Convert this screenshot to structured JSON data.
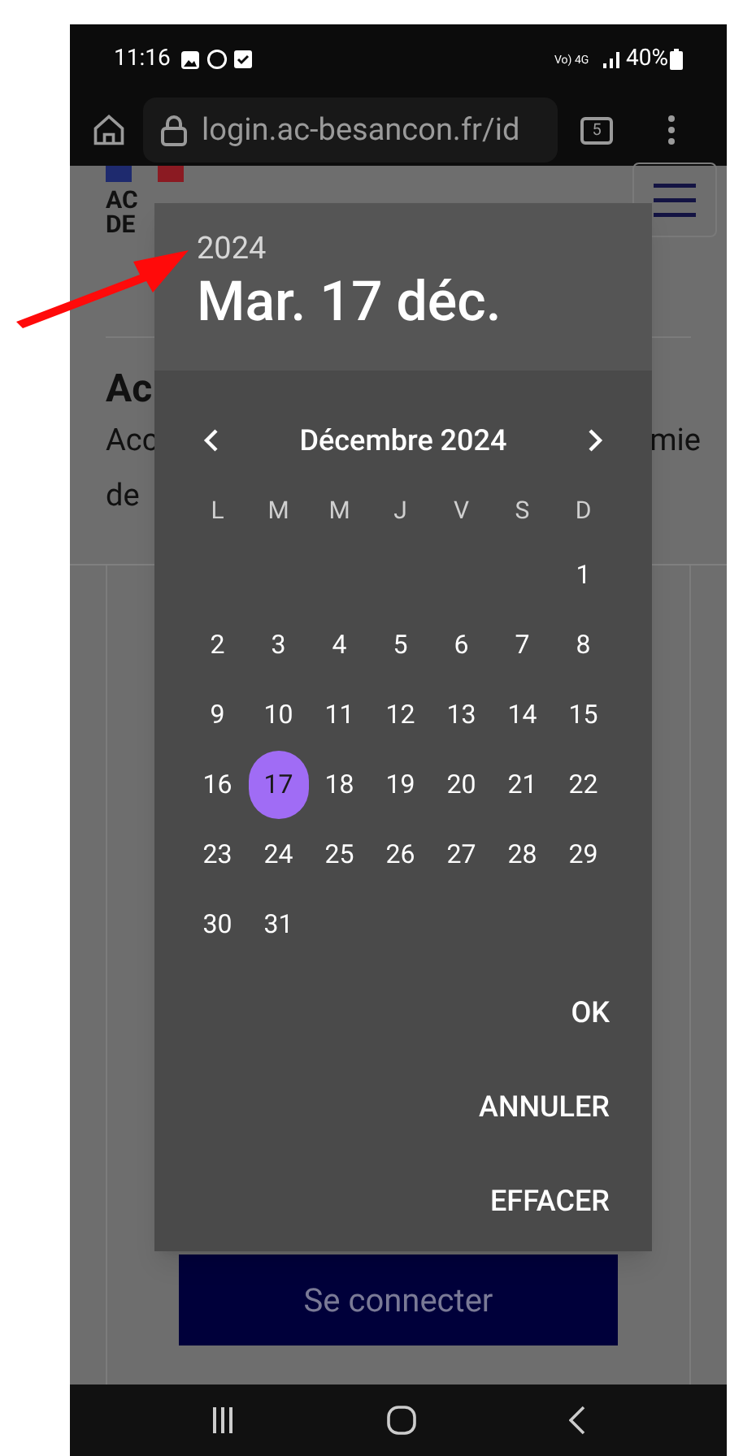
{
  "status_bar": {
    "time": "11:16",
    "network": "Vo) 4G",
    "battery": "40%"
  },
  "browser": {
    "url": "login.ac-besancon.fr/id",
    "tab_count": "5"
  },
  "page": {
    "logo_lines": [
      "AC",
      "DE"
    ],
    "heading": "Ac",
    "paragraph_left": [
      "Acc",
      "de"
    ],
    "paragraph_right": "mie",
    "login_button": "Se connecter"
  },
  "date_picker": {
    "year": "2024",
    "date": "Mar. 17 déc.",
    "month": "Décembre 2024",
    "weekdays": [
      "L",
      "M",
      "M",
      "J",
      "V",
      "S",
      "D"
    ],
    "days": [
      {
        "kind": "blank"
      },
      {
        "kind": "blank"
      },
      {
        "kind": "blank"
      },
      {
        "kind": "blank"
      },
      {
        "kind": "blank"
      },
      {
        "kind": "blank"
      },
      {
        "kind": "day",
        "label": "1",
        "selected": false
      },
      {
        "kind": "day",
        "label": "2",
        "selected": false
      },
      {
        "kind": "day",
        "label": "3",
        "selected": false
      },
      {
        "kind": "day",
        "label": "4",
        "selected": false
      },
      {
        "kind": "day",
        "label": "5",
        "selected": false
      },
      {
        "kind": "day",
        "label": "6",
        "selected": false
      },
      {
        "kind": "day",
        "label": "7",
        "selected": false
      },
      {
        "kind": "day",
        "label": "8",
        "selected": false
      },
      {
        "kind": "day",
        "label": "9",
        "selected": false
      },
      {
        "kind": "day",
        "label": "10",
        "selected": false
      },
      {
        "kind": "day",
        "label": "11",
        "selected": false
      },
      {
        "kind": "day",
        "label": "12",
        "selected": false
      },
      {
        "kind": "day",
        "label": "13",
        "selected": false
      },
      {
        "kind": "day",
        "label": "14",
        "selected": false
      },
      {
        "kind": "day",
        "label": "15",
        "selected": false
      },
      {
        "kind": "day",
        "label": "16",
        "selected": false
      },
      {
        "kind": "day",
        "label": "17",
        "selected": true
      },
      {
        "kind": "day",
        "label": "18",
        "selected": false
      },
      {
        "kind": "day",
        "label": "19",
        "selected": false
      },
      {
        "kind": "day",
        "label": "20",
        "selected": false
      },
      {
        "kind": "day",
        "label": "21",
        "selected": false
      },
      {
        "kind": "day",
        "label": "22",
        "selected": false
      },
      {
        "kind": "day",
        "label": "23",
        "selected": false
      },
      {
        "kind": "day",
        "label": "24",
        "selected": false
      },
      {
        "kind": "day",
        "label": "25",
        "selected": false
      },
      {
        "kind": "day",
        "label": "26",
        "selected": false
      },
      {
        "kind": "day",
        "label": "27",
        "selected": false
      },
      {
        "kind": "day",
        "label": "28",
        "selected": false
      },
      {
        "kind": "day",
        "label": "29",
        "selected": false
      },
      {
        "kind": "day",
        "label": "30",
        "selected": false
      },
      {
        "kind": "day",
        "label": "31",
        "selected": false
      }
    ],
    "actions": [
      "OK",
      "ANNULER",
      "EFFACER"
    ]
  }
}
